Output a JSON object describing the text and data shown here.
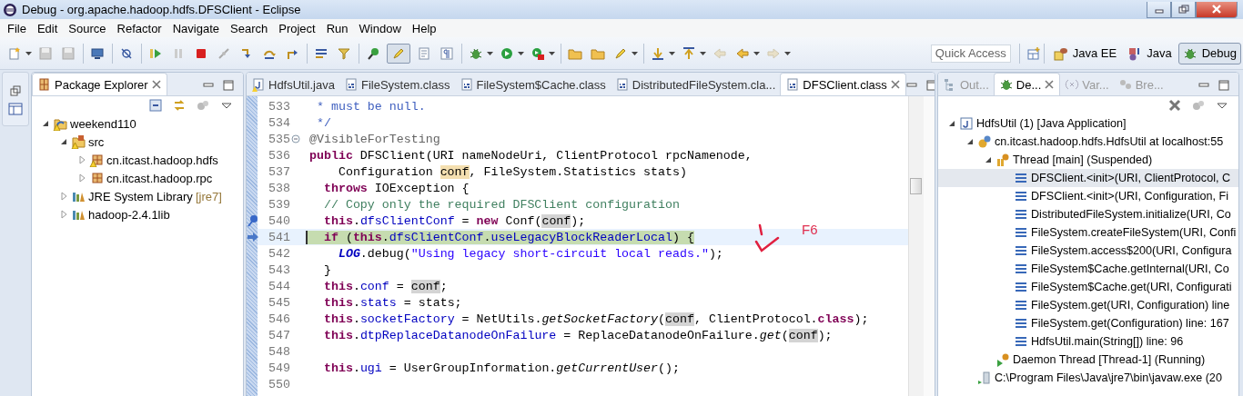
{
  "window": {
    "title": "Debug - org.apache.hadoop.hdfs.DFSClient - Eclipse"
  },
  "menu": [
    "File",
    "Edit",
    "Source",
    "Refactor",
    "Navigate",
    "Search",
    "Project",
    "Run",
    "Window",
    "Help"
  ],
  "mark_occurrences_toggle": {
    "on": true
  },
  "quick_access": {
    "placeholder": "Quick Access"
  },
  "perspectives": [
    {
      "label": "Java EE",
      "kind": "javaee",
      "selected": false
    },
    {
      "label": "Java",
      "kind": "java",
      "selected": false
    },
    {
      "label": "Debug",
      "kind": "debug",
      "selected": true
    }
  ],
  "package_explorer": {
    "title": "Package Explorer",
    "tree": [
      {
        "label": "weekend110",
        "kind": "project",
        "warning": true,
        "expanded": true,
        "children": [
          {
            "label": "src",
            "kind": "source-folder",
            "warning": true,
            "expanded": true,
            "children": [
              {
                "label": "cn.itcast.hadoop.hdfs",
                "kind": "package",
                "warning": true,
                "expanded": false
              },
              {
                "label": "cn.itcast.hadoop.rpc",
                "kind": "package",
                "warning": false,
                "expanded": false
              }
            ]
          },
          {
            "label": "JRE System Library",
            "suffix": "[jre7]",
            "kind": "library",
            "warning": false,
            "expanded": false
          },
          {
            "label": "hadoop-2.4.1lib",
            "kind": "library",
            "warning": false,
            "expanded": false
          }
        ]
      }
    ]
  },
  "editor": {
    "tabs": [
      {
        "label": "HdfsUtil.java",
        "kind": "java",
        "selected": false
      },
      {
        "label": "FileSystem.class",
        "kind": "class",
        "selected": false
      },
      {
        "label": "FileSystem$Cache.class",
        "kind": "class",
        "selected": false
      },
      {
        "label": "DistributedFileSystem.cla...",
        "kind": "class",
        "selected": false
      },
      {
        "label": "DFSClient.class",
        "kind": "class",
        "selected": true
      }
    ],
    "lines": [
      {
        "number": "533",
        "current": false,
        "segments": [
          {
            "text": " * must be null.",
            "kind": "doc"
          }
        ]
      },
      {
        "number": "534",
        "current": false,
        "segments": [
          {
            "text": " */",
            "kind": "doc"
          }
        ]
      },
      {
        "number": "535",
        "current": false,
        "marker": {
          "kind": "fold"
        },
        "segments": [
          {
            "text": "@VisibleForTesting",
            "kind": "ann"
          }
        ]
      },
      {
        "number": "536",
        "current": false,
        "segments": [
          {
            "text": "public",
            "kind": "kw"
          },
          {
            "text": " DFSClient(URI nameNodeUri, ClientProtocol rpcNamenode,",
            "kind": "plain"
          }
        ]
      },
      {
        "number": "537",
        "current": false,
        "segments": [
          {
            "text": "    Configuration ",
            "kind": "plain"
          },
          {
            "text": "conf",
            "kind": "occ-write"
          },
          {
            "text": ", FileSystem.Statistics stats)",
            "kind": "plain"
          }
        ]
      },
      {
        "number": "538",
        "current": false,
        "segments": [
          {
            "text": "  throws",
            "kind": "kw"
          },
          {
            "text": " IOException {",
            "kind": "plain"
          }
        ]
      },
      {
        "number": "539",
        "current": false,
        "segments": [
          {
            "text": "  // Copy only the required DFSClient configuration",
            "kind": "comment"
          }
        ]
      },
      {
        "number": "540",
        "current": false,
        "marker": {
          "kind": "breakpoint"
        },
        "segments": [
          {
            "text": "  this",
            "kind": "kw"
          },
          {
            "text": ".",
            "kind": "plain"
          },
          {
            "text": "dfsClientConf",
            "kind": "field"
          },
          {
            "text": " = ",
            "kind": "plain"
          },
          {
            "text": "new",
            "kind": "kw"
          },
          {
            "text": " Conf(",
            "kind": "plain"
          },
          {
            "text": "conf",
            "kind": "occ"
          },
          {
            "text": ");",
            "kind": "plain"
          }
        ]
      },
      {
        "number": "541",
        "current": true,
        "marker": {
          "kind": "pointer"
        },
        "segments": [
          {
            "text": "  if",
            "kind": "kw"
          },
          {
            "text": " (",
            "kind": "plain"
          },
          {
            "text": "this",
            "kind": "kw"
          },
          {
            "text": ".",
            "kind": "plain"
          },
          {
            "text": "dfsClientConf",
            "kind": "field"
          },
          {
            "text": ".",
            "kind": "plain"
          },
          {
            "text": "useLegacyBlockReaderLocal",
            "kind": "field"
          },
          {
            "text": ") {",
            "kind": "plain"
          }
        ]
      },
      {
        "number": "542",
        "current": false,
        "segments": [
          {
            "text": "    LOG",
            "kind": "static"
          },
          {
            "text": ".debug(",
            "kind": "plain"
          },
          {
            "text": "\"Using legacy short-circuit local reads.\"",
            "kind": "string"
          },
          {
            "text": ");",
            "kind": "plain"
          }
        ]
      },
      {
        "number": "543",
        "current": false,
        "segments": [
          {
            "text": "  }",
            "kind": "plain"
          }
        ]
      },
      {
        "number": "544",
        "current": false,
        "segments": [
          {
            "text": "  this",
            "kind": "kw"
          },
          {
            "text": ".",
            "kind": "plain"
          },
          {
            "text": "conf",
            "kind": "field"
          },
          {
            "text": " = ",
            "kind": "plain"
          },
          {
            "text": "conf",
            "kind": "occ"
          },
          {
            "text": ";",
            "kind": "plain"
          }
        ]
      },
      {
        "number": "545",
        "current": false,
        "segments": [
          {
            "text": "  this",
            "kind": "kw"
          },
          {
            "text": ".",
            "kind": "plain"
          },
          {
            "text": "stats",
            "kind": "field"
          },
          {
            "text": " = stats;",
            "kind": "plain"
          }
        ]
      },
      {
        "number": "546",
        "current": false,
        "segments": [
          {
            "text": "  this",
            "kind": "kw"
          },
          {
            "text": ".",
            "kind": "plain"
          },
          {
            "text": "socketFactory",
            "kind": "field"
          },
          {
            "text": " = NetUtils.",
            "kind": "plain"
          },
          {
            "text": "getSocketFactory",
            "kind": "italic"
          },
          {
            "text": "(",
            "kind": "plain"
          },
          {
            "text": "conf",
            "kind": "occ"
          },
          {
            "text": ", ClientProtocol.",
            "kind": "plain"
          },
          {
            "text": "class",
            "kind": "kw"
          },
          {
            "text": ");",
            "kind": "plain"
          }
        ]
      },
      {
        "number": "547",
        "current": false,
        "segments": [
          {
            "text": "  this",
            "kind": "kw"
          },
          {
            "text": ".",
            "kind": "plain"
          },
          {
            "text": "dtpReplaceDatanodeOnFailure",
            "kind": "field"
          },
          {
            "text": " = ReplaceDatanodeOnFailure.",
            "kind": "plain"
          },
          {
            "text": "get",
            "kind": "italic"
          },
          {
            "text": "(",
            "kind": "plain"
          },
          {
            "text": "conf",
            "kind": "occ"
          },
          {
            "text": ");",
            "kind": "plain"
          }
        ]
      },
      {
        "number": "548",
        "current": false
      },
      {
        "number": "549",
        "current": false,
        "segments": [
          {
            "text": "  this",
            "kind": "kw"
          },
          {
            "text": ".",
            "kind": "plain"
          },
          {
            "text": "ugi",
            "kind": "field"
          },
          {
            "text": " = UserGroupInformation.",
            "kind": "plain"
          },
          {
            "text": "getCurrentUser",
            "kind": "italic"
          },
          {
            "text": "();",
            "kind": "plain"
          }
        ]
      },
      {
        "number": "550",
        "current": false
      }
    ],
    "annotation": {
      "text": "F6"
    }
  },
  "debug_view": {
    "tabs": [
      {
        "label": "Out...",
        "kind": "outline",
        "selected": false
      },
      {
        "label": "De...",
        "kind": "debug",
        "selected": true
      },
      {
        "label": "Var...",
        "kind": "variables",
        "selected": false
      },
      {
        "label": "Bre...",
        "kind": "breakpoints",
        "selected": false
      }
    ],
    "tree": [
      {
        "label": "HdfsUtil (1) [Java Application]",
        "kind": "launch",
        "selected": false,
        "expanded": true,
        "children": [
          {
            "label": "cn.itcast.hadoop.hdfs.HdfsUtil at localhost:55",
            "kind": "vm",
            "selected": false,
            "expanded": true,
            "children": [
              {
                "label": "Thread [main] (Suspended)",
                "kind": "thread",
                "suspended": true,
                "selected": false,
                "expanded": true,
                "children": [
                  {
                    "label": "DFSClient.<init>(URI, ClientProtocol, C",
                    "kind": "frame",
                    "selected": true
                  },
                  {
                    "label": "DFSClient.<init>(URI, Configuration, Fi",
                    "kind": "frame",
                    "selected": false
                  },
                  {
                    "label": "DistributedFileSystem.initialize(URI, Co",
                    "kind": "frame",
                    "selected": false
                  },
                  {
                    "label": "FileSystem.createFileSystem(URI, Confi",
                    "kind": "frame",
                    "selected": false
                  },
                  {
                    "label": "FileSystem.access$200(URI, Configura",
                    "kind": "frame",
                    "selected": false
                  },
                  {
                    "label": "FileSystem$Cache.getInternal(URI, Co",
                    "kind": "frame",
                    "selected": false
                  },
                  {
                    "label": "FileSystem$Cache.get(URI, Configurati",
                    "kind": "frame",
                    "selected": false
                  },
                  {
                    "label": "FileSystem.get(URI, Configuration) line",
                    "kind": "frame",
                    "selected": false
                  },
                  {
                    "label": "FileSystem.get(Configuration) line: 167",
                    "kind": "frame",
                    "selected": false
                  },
                  {
                    "label": "HdfsUtil.main(String[]) line: 96",
                    "kind": "frame",
                    "selected": false
                  }
                ]
              },
              {
                "label": "Daemon Thread [Thread-1] (Running)",
                "kind": "thread",
                "suspended": false,
                "selected": false
              }
            ]
          },
          {
            "label": "C:\\Program Files\\Java\\jre7\\bin\\javaw.exe (20",
            "kind": "process",
            "selected": false
          }
        ]
      }
    ]
  }
}
